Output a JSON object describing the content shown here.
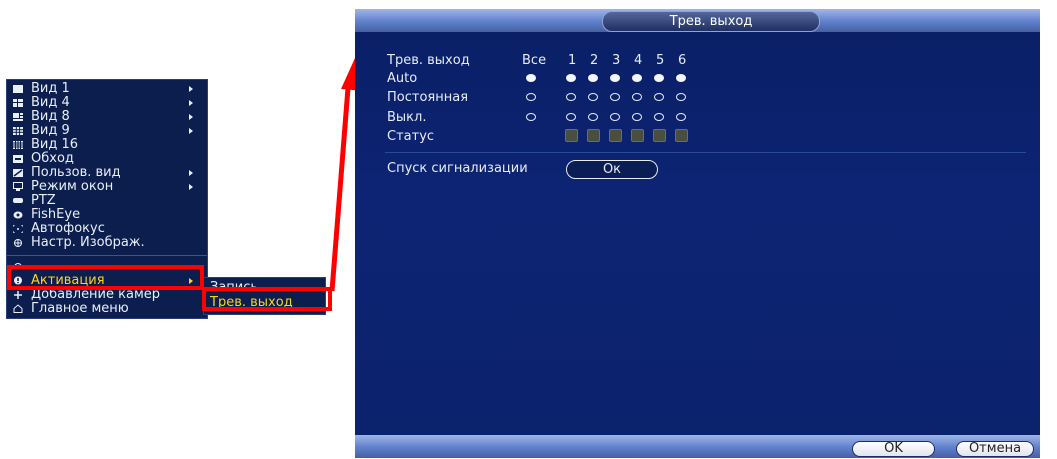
{
  "context_menu": {
    "items": [
      {
        "label": "Вид 1",
        "icon": "view1-icon"
      },
      {
        "label": "Вид 4",
        "icon": "view4-icon"
      },
      {
        "label": "Вид 8",
        "icon": "view8-icon"
      },
      {
        "label": "Вид 9",
        "icon": "view9-icon"
      },
      {
        "label": "Вид 16",
        "icon": "view16-icon"
      },
      {
        "label": "Обход",
        "icon": "tour-icon"
      },
      {
        "label": "Пользов. вид",
        "icon": "custom-view-icon"
      },
      {
        "label": "Режим окон",
        "icon": "window-mode-icon"
      },
      {
        "label": "PTZ",
        "icon": "ptz-icon"
      },
      {
        "label": "FishEye",
        "icon": "fisheye-icon"
      },
      {
        "label": "Автофокус",
        "icon": "autofocus-icon"
      },
      {
        "label": "Настр. Изображ.",
        "icon": "image-settings-icon"
      },
      {
        "label": "Активация",
        "icon": "activation-icon"
      },
      {
        "label": "Добавление камер",
        "icon": "add-camera-icon"
      },
      {
        "label": "Главное меню",
        "icon": "home-icon"
      }
    ],
    "submenu": [
      "Запись",
      "Трев. выход"
    ]
  },
  "dialog": {
    "title": "Трев. выход",
    "header_label": "Трев. выход",
    "all_label": "Все",
    "channels": [
      "1",
      "2",
      "3",
      "4",
      "5",
      "6"
    ],
    "rows": [
      {
        "label": "Auto",
        "all": "filled",
        "states": [
          "filled",
          "filled",
          "filled",
          "filled",
          "filled",
          "filled"
        ]
      },
      {
        "label": "Постоянная",
        "all": "empty",
        "states": [
          "empty",
          "empty",
          "empty",
          "empty",
          "empty",
          "empty"
        ]
      },
      {
        "label": "Выкл.",
        "all": "empty",
        "states": [
          "empty",
          "empty",
          "empty",
          "empty",
          "empty",
          "empty"
        ]
      }
    ],
    "status_label": "Статус",
    "alarm_release_label": "Спуск сигнализации",
    "ok_inline_label": "Ок",
    "ok_label": "OK",
    "cancel_label": "Отмена"
  },
  "colors": {
    "highlight": "#ff0000",
    "menu_bg": "#0c1e4e",
    "dialog_bg": "#0b2166",
    "active_text": "#ffd21a"
  }
}
